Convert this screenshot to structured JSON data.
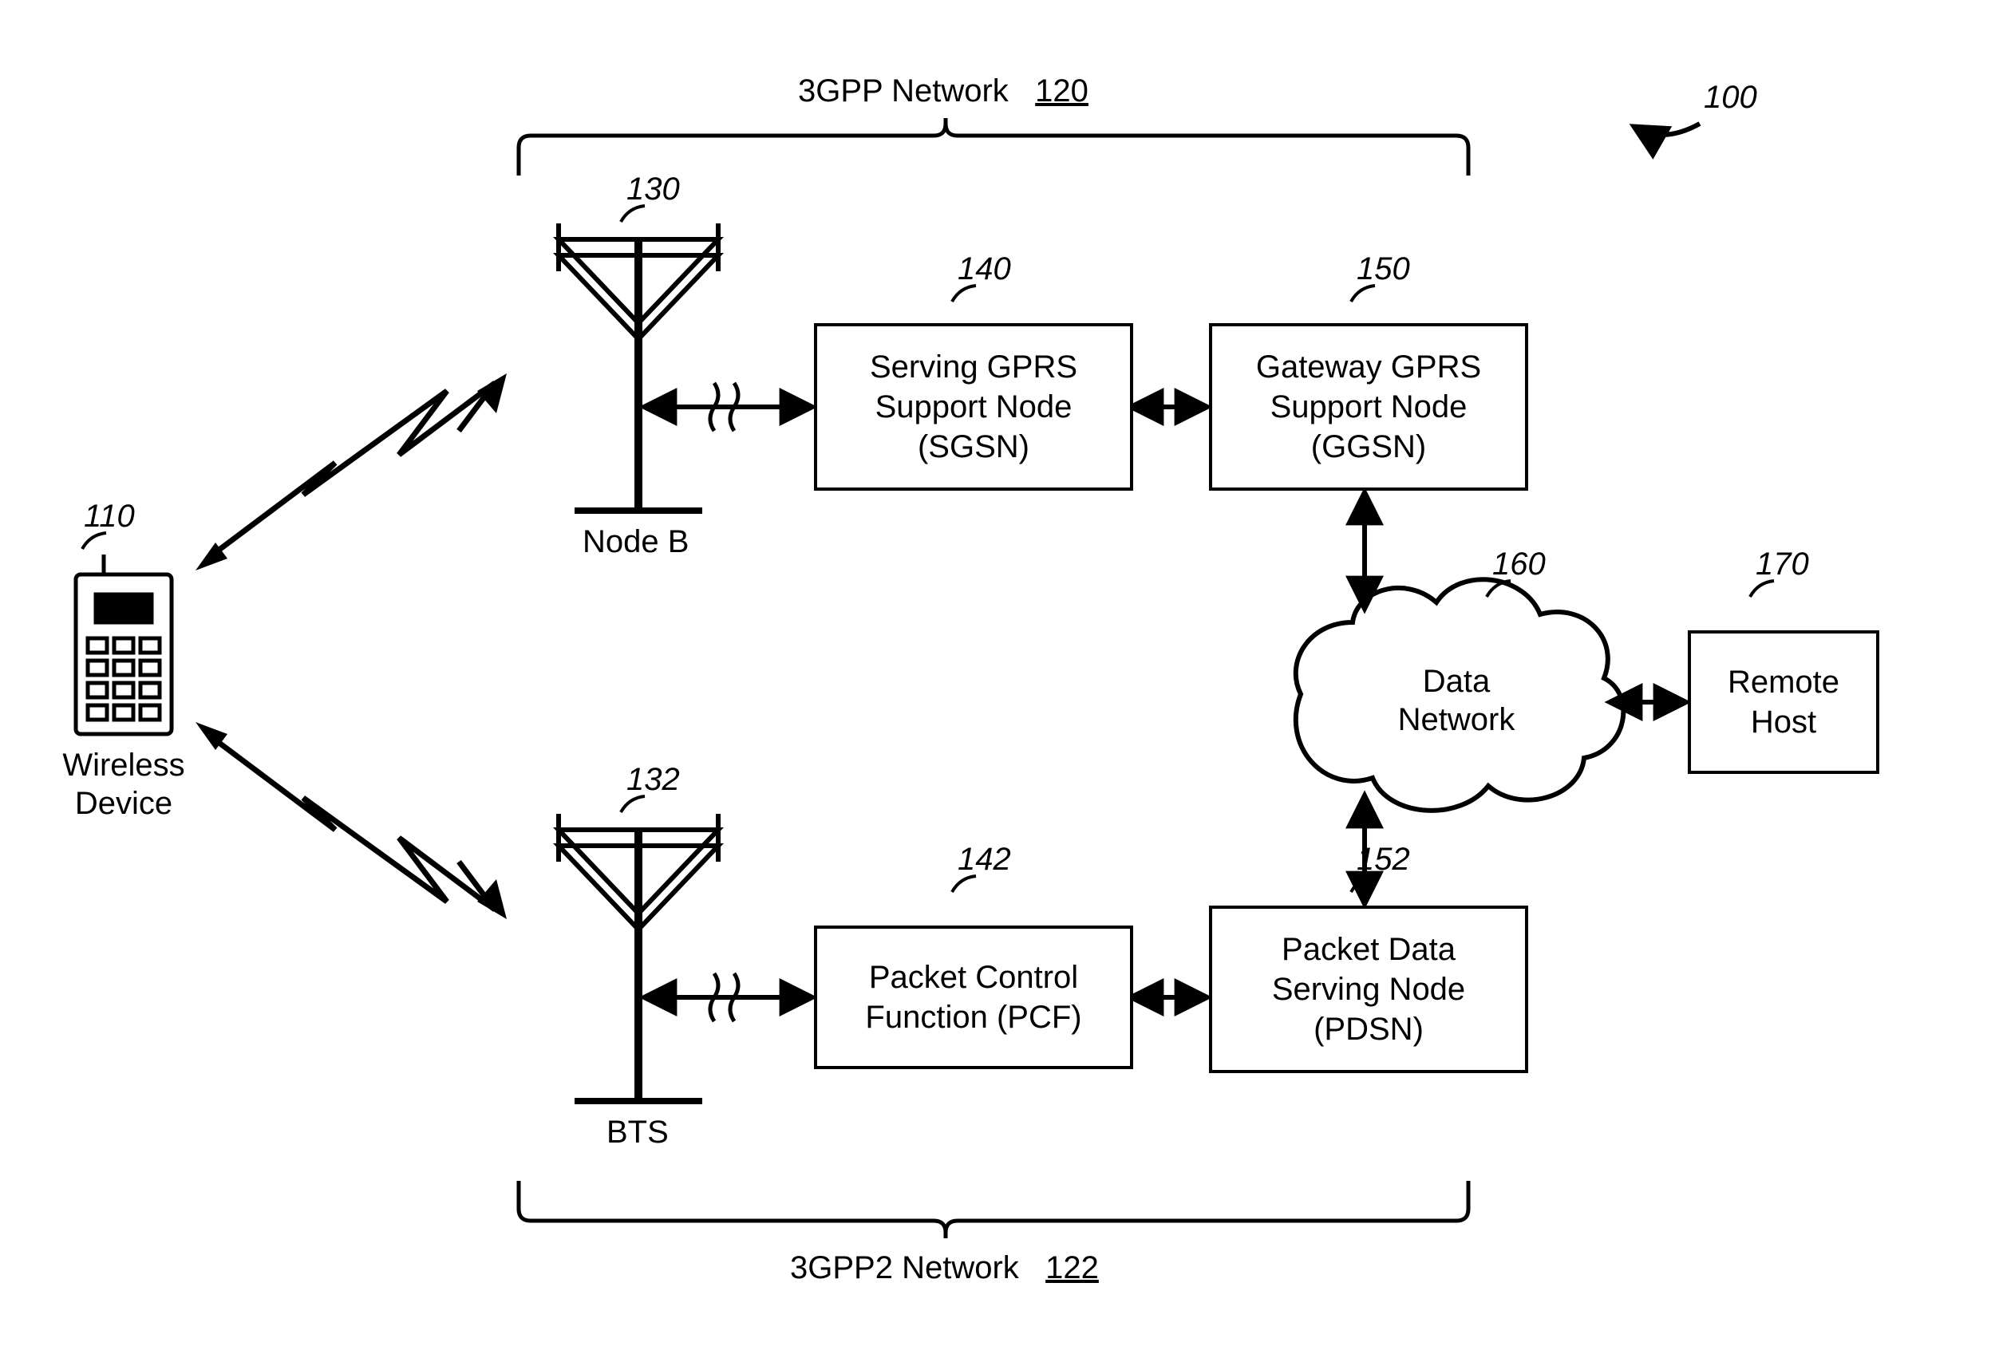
{
  "diagram": {
    "ref100": "100",
    "topNetworkLabel": "3GPP Network",
    "topNetworkRef": "120",
    "bottomNetworkLabel": "3GPP2 Network",
    "bottomNetworkRef": "122",
    "wireless": {
      "ref110": "110",
      "label1": "Wireless",
      "label2": "Device"
    },
    "nodeB": {
      "ref130": "130",
      "label": "Node B"
    },
    "bts": {
      "ref132": "132",
      "label": "BTS"
    },
    "sgsn": {
      "ref140": "140",
      "l1": "Serving GPRS",
      "l2": "Support Node",
      "l3": "(SGSN)"
    },
    "ggsn": {
      "ref150": "150",
      "l1": "Gateway GPRS",
      "l2": "Support Node",
      "l3": "(GGSN)"
    },
    "pcf": {
      "ref142": "142",
      "l1": "Packet Control",
      "l2": "Function (PCF)"
    },
    "pdsn": {
      "ref152": "152",
      "l1": "Packet Data",
      "l2": "Serving Node",
      "l3": "(PDSN)"
    },
    "datanet": {
      "ref160": "160",
      "l1": "Data",
      "l2": "Network"
    },
    "remote": {
      "ref170": "170",
      "l1": "Remote",
      "l2": "Host"
    }
  }
}
